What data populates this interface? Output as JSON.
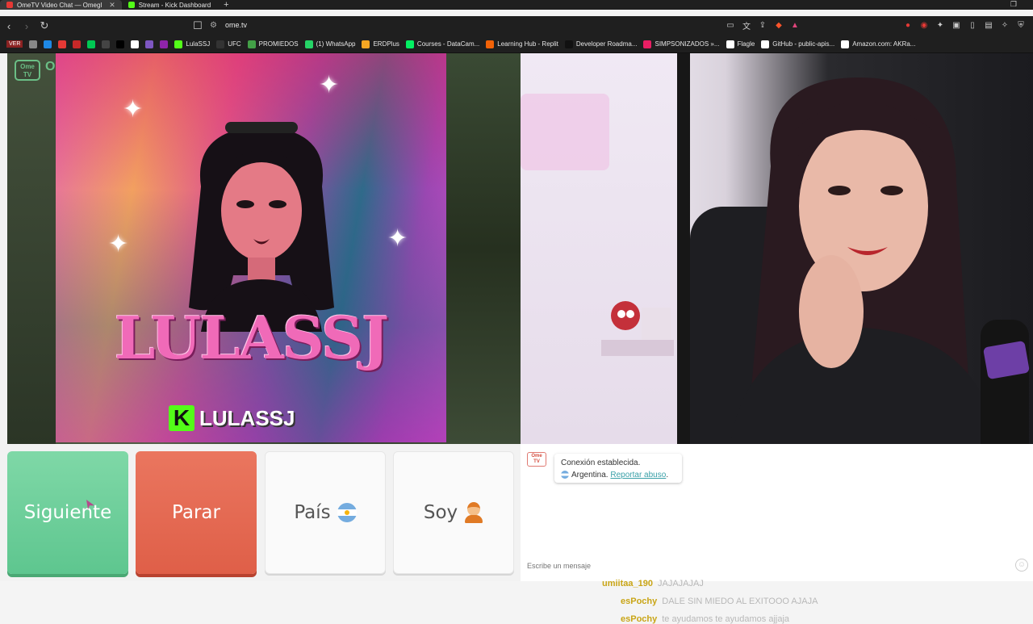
{
  "browser": {
    "tabs": [
      {
        "title": "OmeTV Video Chat — Omegl",
        "active": true,
        "favicon_color": "#e53935"
      },
      {
        "title": "Stream - Kick Dashboard",
        "active": false,
        "favicon_color": "#53fc18"
      }
    ],
    "new_tab": "+",
    "url": "ome.tv",
    "bookmarks": [
      {
        "label": "VER",
        "color": "#8b2222"
      },
      {
        "label": "",
        "color": "#888888"
      },
      {
        "label": "",
        "color": "#1e88e5"
      },
      {
        "label": "",
        "color": "#e53935"
      },
      {
        "label": "",
        "color": "#c62828"
      },
      {
        "label": "",
        "color": "#00c853"
      },
      {
        "label": "",
        "color": "#444444"
      },
      {
        "label": "",
        "color": "#000000"
      },
      {
        "label": "",
        "color": "#ffffff"
      },
      {
        "label": "",
        "color": "#7e57c2"
      },
      {
        "label": "",
        "color": "#8e24aa"
      },
      {
        "label": "LulaSSJ",
        "color": "#53fc18"
      },
      {
        "label": "UFC",
        "color": "#333333"
      },
      {
        "label": "PROMIEDOS",
        "color": "#43a047"
      },
      {
        "label": "(1) WhatsApp",
        "color": "#25d366"
      },
      {
        "label": "ERDPlus",
        "color": "#f5a623"
      },
      {
        "label": "Courses - DataCam...",
        "color": "#03ef62"
      },
      {
        "label": "Learning Hub - Replit",
        "color": "#f26207"
      },
      {
        "label": "Developer Roadma...",
        "color": "#111111"
      },
      {
        "label": "SIMPSONIZADOS »...",
        "color": "#e91e63"
      },
      {
        "label": "Flagle",
        "color": "#ffffff"
      },
      {
        "label": "GitHub - public-apis...",
        "color": "#ffffff"
      },
      {
        "label": "Amazon.com: AKRa...",
        "color": "#ffffff"
      }
    ]
  },
  "poster": {
    "title": "LULASSJ",
    "kick_letter": "K",
    "kick_name": "LULASSJ"
  },
  "left_logo": {
    "line1": "Ome",
    "line2": "TV",
    "extra": "O"
  },
  "buttons": {
    "next": "Siguiente",
    "stop": "Parar",
    "country": "País",
    "gender": "Soy"
  },
  "chat": {
    "logo_line1": "Ome",
    "logo_line2": "TV",
    "connected": "Conexión establecida.",
    "country": "Argentina.",
    "report": "Reportar abuso",
    "report_suffix": ".",
    "messages": [
      {
        "user": "umiitaa_190",
        "text": "JAJAJAJAJ"
      },
      {
        "user": "esPochy",
        "text": "DALE SIN MIEDO AL EXITOOO AJAJA"
      },
      {
        "user": "esPochy",
        "text": "te ayudamos te ayudamos ajjaja"
      }
    ],
    "input_placeholder": "Escribe un mensaje"
  }
}
